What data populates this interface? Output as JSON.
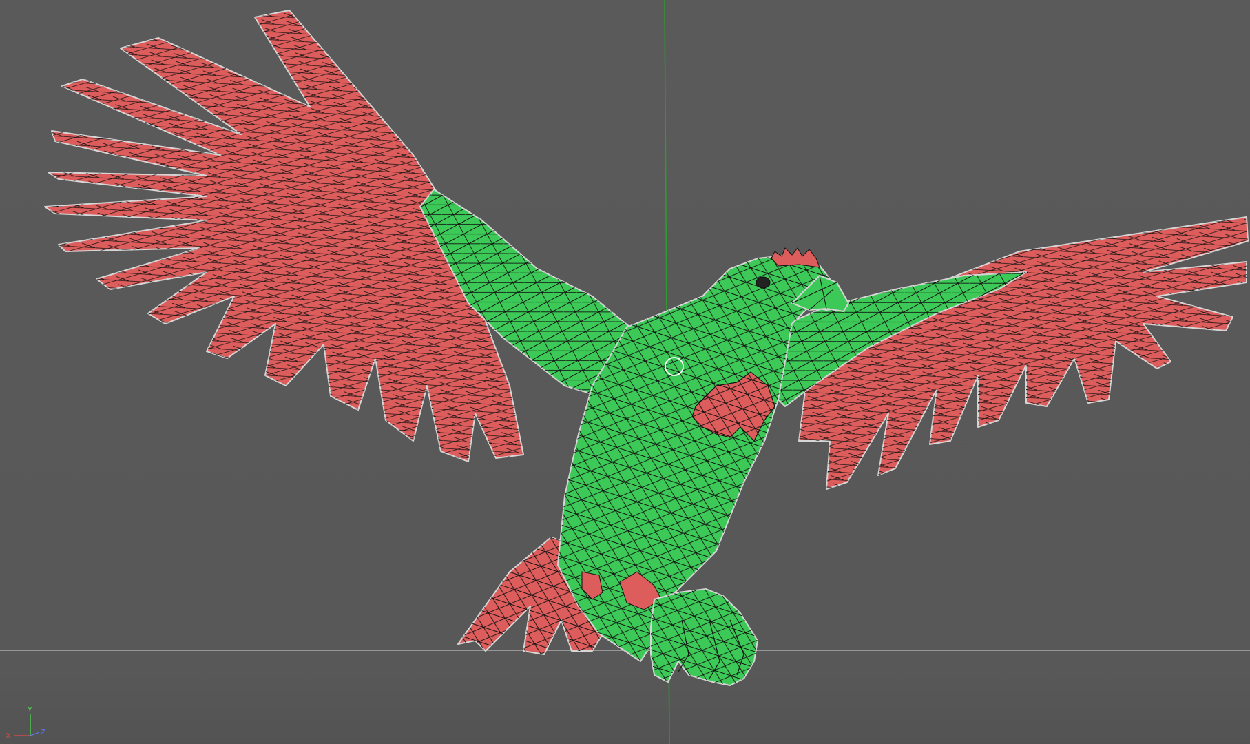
{
  "viewport": {
    "name": "3d-viewport",
    "background_color": "#595959",
    "display_mode": "wireframe-on-shaded",
    "grid": {
      "vertical_axis_color": "#2f9a2f",
      "horizontal_axis_color": "#bdbdbd"
    },
    "model": {
      "name": "eagle-mesh",
      "body_color": "#3cc957",
      "feather_color": "#dd5c5c",
      "wire_color": "#111111",
      "outline_color": "#d6d6d6"
    },
    "pivot_icon": "pivot-circle-icon"
  },
  "axis_gizmo": {
    "x_label": "X",
    "y_label": "Y",
    "z_label": "Z",
    "x_color": "#d24a4a",
    "y_color": "#4fcf4f",
    "z_color": "#5a78e6"
  }
}
